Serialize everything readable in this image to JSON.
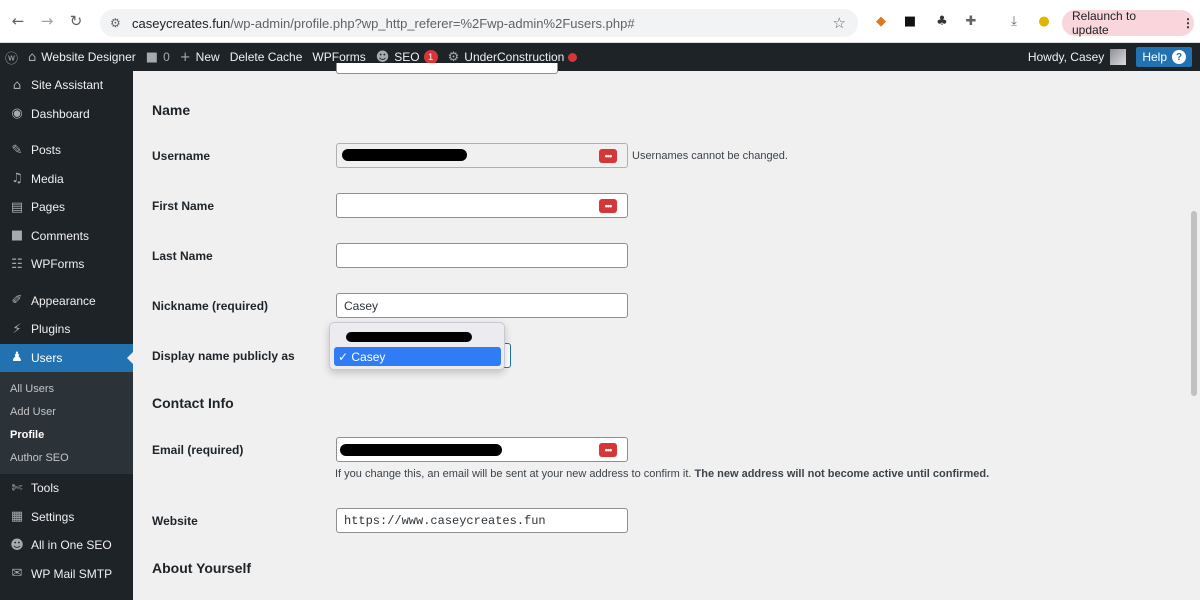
{
  "browser": {
    "url_host": "caseycreates.fun",
    "url_path": "/wp-admin/profile.php?wp_http_referer=%2Fwp-admin%2Fusers.php#",
    "relaunch_label": "Relaunch to update"
  },
  "adminbar": {
    "site_name": "Website Designer",
    "comments_count": "0",
    "new_label": "New",
    "delete_cache_label": "Delete Cache",
    "wpforms_label": "WPForms",
    "seo_label": "SEO",
    "seo_badge": "1",
    "underconstruction_label": "UnderConstruction",
    "howdy": "Howdy, Casey",
    "help_label": "Help"
  },
  "sidebar": {
    "items": [
      {
        "label": "Site Assistant",
        "icon": "home-icon"
      },
      {
        "label": "Dashboard",
        "icon": "dashboard-icon"
      },
      {
        "label": "Posts",
        "icon": "pin-icon"
      },
      {
        "label": "Media",
        "icon": "media-icon"
      },
      {
        "label": "Pages",
        "icon": "page-icon"
      },
      {
        "label": "Comments",
        "icon": "comment-icon"
      },
      {
        "label": "WPForms",
        "icon": "form-icon"
      },
      {
        "label": "Appearance",
        "icon": "brush-icon"
      },
      {
        "label": "Plugins",
        "icon": "plugin-icon"
      },
      {
        "label": "Users",
        "icon": "user-icon"
      },
      {
        "label": "Tools",
        "icon": "wrench-icon"
      },
      {
        "label": "Settings",
        "icon": "settings-icon"
      },
      {
        "label": "All in One SEO",
        "icon": "seo-icon"
      },
      {
        "label": "WP Mail SMTP",
        "icon": "mail-icon"
      }
    ],
    "submenu": [
      "All Users",
      "Add User",
      "Profile",
      "Author SEO"
    ]
  },
  "form": {
    "section_name": "Name",
    "username_label": "Username",
    "username_note": "Usernames cannot be changed.",
    "first_name_label": "First Name",
    "last_name_label": "Last Name",
    "nickname_label": "Nickname (required)",
    "nickname_value": "Casey",
    "display_name_label": "Display name publicly as",
    "display_option_selected": "✓ Casey",
    "section_contact": "Contact Info",
    "email_label": "Email (required)",
    "email_note_plain": "If you change this, an email will be sent at your new address to confirm it.",
    "email_note_bold": "The new address will not become active until confirmed.",
    "website_label": "Website",
    "website_value": "https://www.caseycreates.fun",
    "section_about": "About Yourself"
  }
}
